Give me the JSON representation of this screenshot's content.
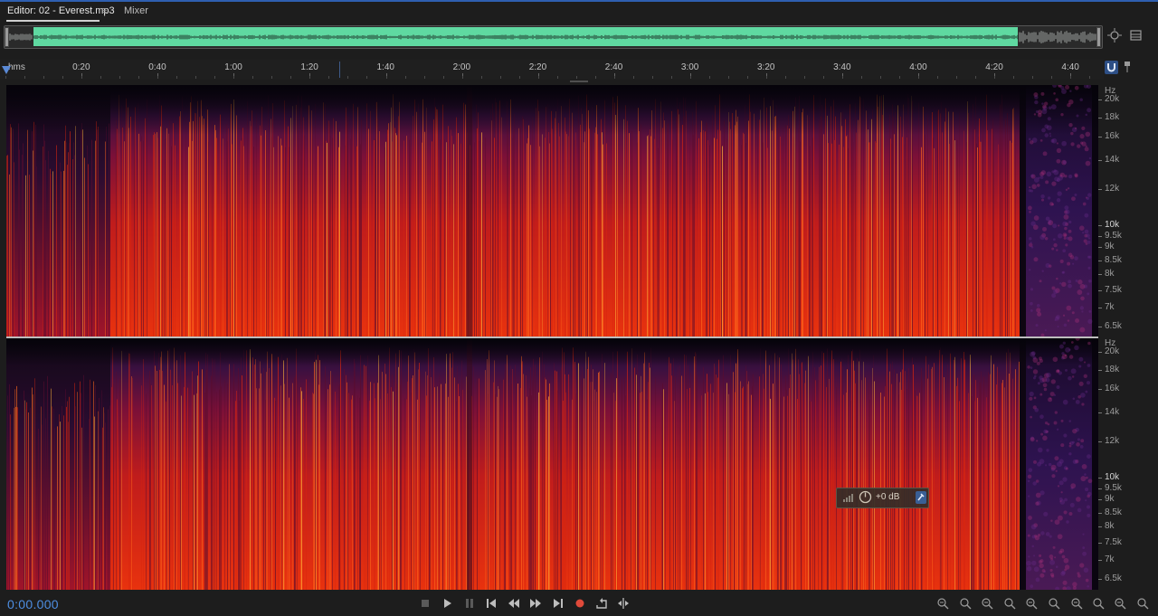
{
  "tabs": {
    "editor_label": "Editor: 02 - Everest.mp3",
    "editor_menu": "≡",
    "mixer_label": "Mixer"
  },
  "overview": {
    "wave_color": "#5fd9a1",
    "background": "#2a2a2a"
  },
  "ruler": {
    "unit_label": "hms",
    "ticks": [
      "0:20",
      "0:40",
      "1:00",
      "1:20",
      "1:40",
      "2:00",
      "2:20",
      "2:40",
      "3:00",
      "3:20",
      "3:40",
      "4:00",
      "4:20",
      "4:40"
    ]
  },
  "frequency_axis": {
    "unit": "Hz",
    "labels": [
      {
        "text": "20k",
        "major": false
      },
      {
        "text": "18k",
        "major": false
      },
      {
        "text": "16k",
        "major": false
      },
      {
        "text": "14k",
        "major": false
      },
      {
        "text": "12k",
        "major": false
      },
      {
        "text": "10k",
        "major": true
      },
      {
        "text": "9.5k",
        "major": false
      },
      {
        "text": "9k",
        "major": false
      },
      {
        "text": "8.5k",
        "major": false
      },
      {
        "text": "8k",
        "major": false
      },
      {
        "text": "7.5k",
        "major": false
      },
      {
        "text": "7k",
        "major": false
      },
      {
        "text": "6.5k",
        "major": false
      }
    ]
  },
  "spectral_colors": {
    "low": "#120816",
    "mid": "#7a1038",
    "high": "#e8320e",
    "peak": "#ffb43a"
  },
  "hud": {
    "gain_value": "+0 dB",
    "meter_icon": "level-meter-icon",
    "knob_icon": "volume-knob-icon",
    "pin_icon": "pin-icon"
  },
  "transport": {
    "timecode": "0:00.000",
    "buttons": [
      "stop-icon",
      "play-icon",
      "pause-icon",
      "skip-to-start-icon",
      "rewind-icon",
      "fast-forward-icon",
      "skip-to-end-icon",
      "record-icon",
      "loop-playback-icon",
      "skip-selection-icon"
    ],
    "record_color": "#e04a3a"
  },
  "zoom_tools": [
    "zoom-in-amplitude-icon",
    "zoom-out-amplitude-icon",
    "zoom-to-selection-icon",
    "zoom-out-full-icon",
    "zoom-in-left-icon",
    "zoom-in-time-icon",
    "zoom-out-time-icon",
    "zoom-in-frequency-icon",
    "zoom-out-frequency-icon",
    "zoom-reset-icon",
    "zoom-full-icon"
  ]
}
